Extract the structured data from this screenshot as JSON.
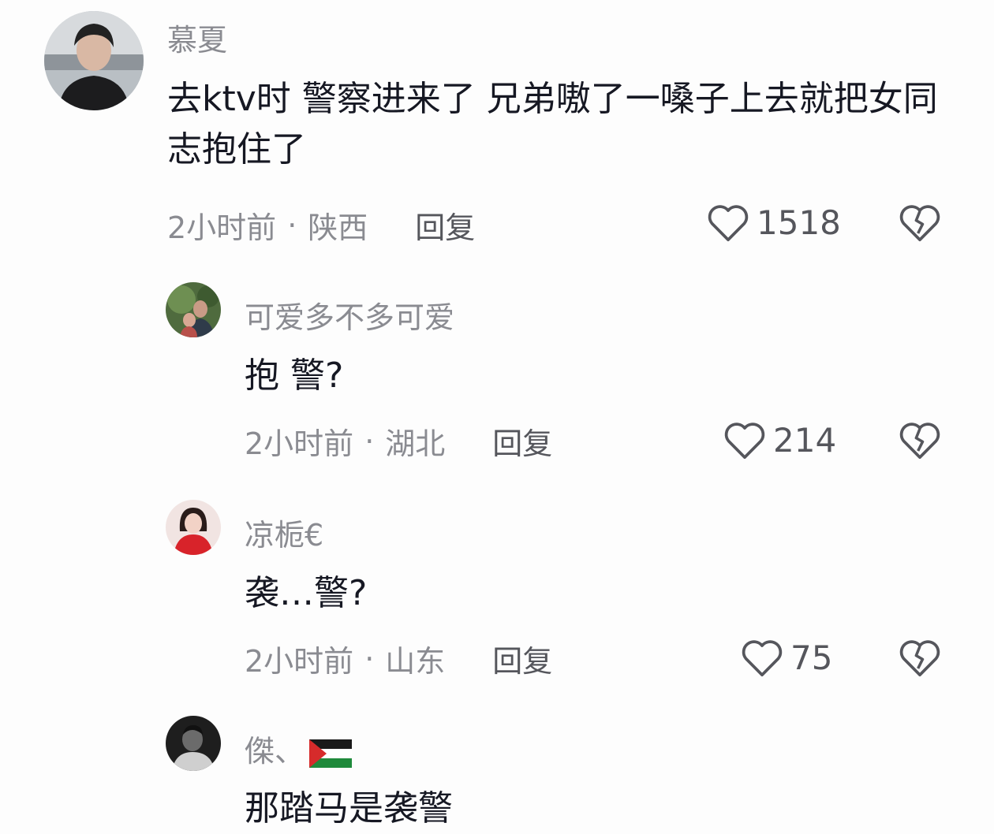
{
  "comments": [
    {
      "username": "慕夏",
      "content": "去ktv时 警察进来了 兄弟嗷了一嗓子上去就把女同志抱住了",
      "time": "2小时前",
      "location": "陕西",
      "reply_label": "回复",
      "likes": "1518",
      "avatar_icon": "avatar-photo-icon"
    },
    {
      "username": "可爱多不多可爱",
      "content": "抱 警?",
      "time": "2小时前",
      "location": "湖北",
      "reply_label": "回复",
      "likes": "214",
      "avatar_icon": "avatar-photo-icon"
    },
    {
      "username": "凉栀€",
      "content": "袭…警?",
      "time": "2小时前",
      "location": "山东",
      "reply_label": "回复",
      "likes": "75",
      "avatar_icon": "avatar-photo-icon"
    },
    {
      "username": "傑、",
      "content": "那踏马是袭警",
      "avatar_icon": "avatar-photo-icon",
      "username_flag": "palestine-flag-icon"
    }
  ],
  "separator": "·",
  "icons": {
    "like": "heart-outline-icon",
    "dislike": "broken-heart-icon"
  },
  "colors": {
    "meta_text": "#8a8b91",
    "body_text": "#161823",
    "background": "#fdfdfd"
  }
}
